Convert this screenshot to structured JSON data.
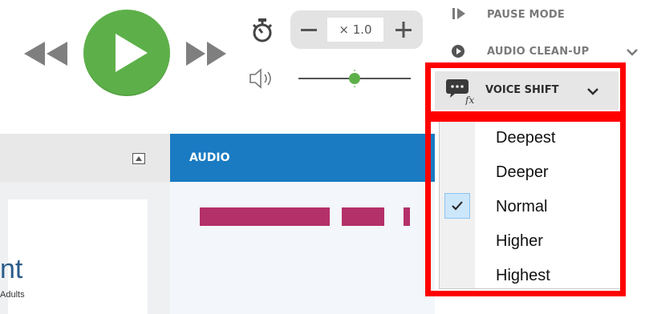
{
  "transport": {
    "rewind_icon": "rewind-icon",
    "play_icon": "play-icon",
    "forward_icon": "fast-forward-icon",
    "play_color": "#5db049"
  },
  "speed": {
    "timer_icon": "stopwatch-icon",
    "minus": "−",
    "value": "× 1.0",
    "plus": "+"
  },
  "volume": {
    "icon": "speaker-icon",
    "level": 0.55
  },
  "menu": {
    "pause_mode": "PAUSE MODE",
    "audio_cleanup": "AUDIO CLEAN-UP",
    "voice_shift": "VOICE SHIFT"
  },
  "voice_shift_options": [
    "Deepest",
    "Deeper",
    "Normal",
    "Higher",
    "Highest"
  ],
  "selected_option": "Normal",
  "panels": {
    "audio_title": "AUDIO",
    "left_text_partial": "nt",
    "left_small_text": "Adults"
  },
  "colors": {
    "accent_blue": "#1a7bc2",
    "highlight_red": "#ff0000",
    "waveform": "#b43068"
  }
}
